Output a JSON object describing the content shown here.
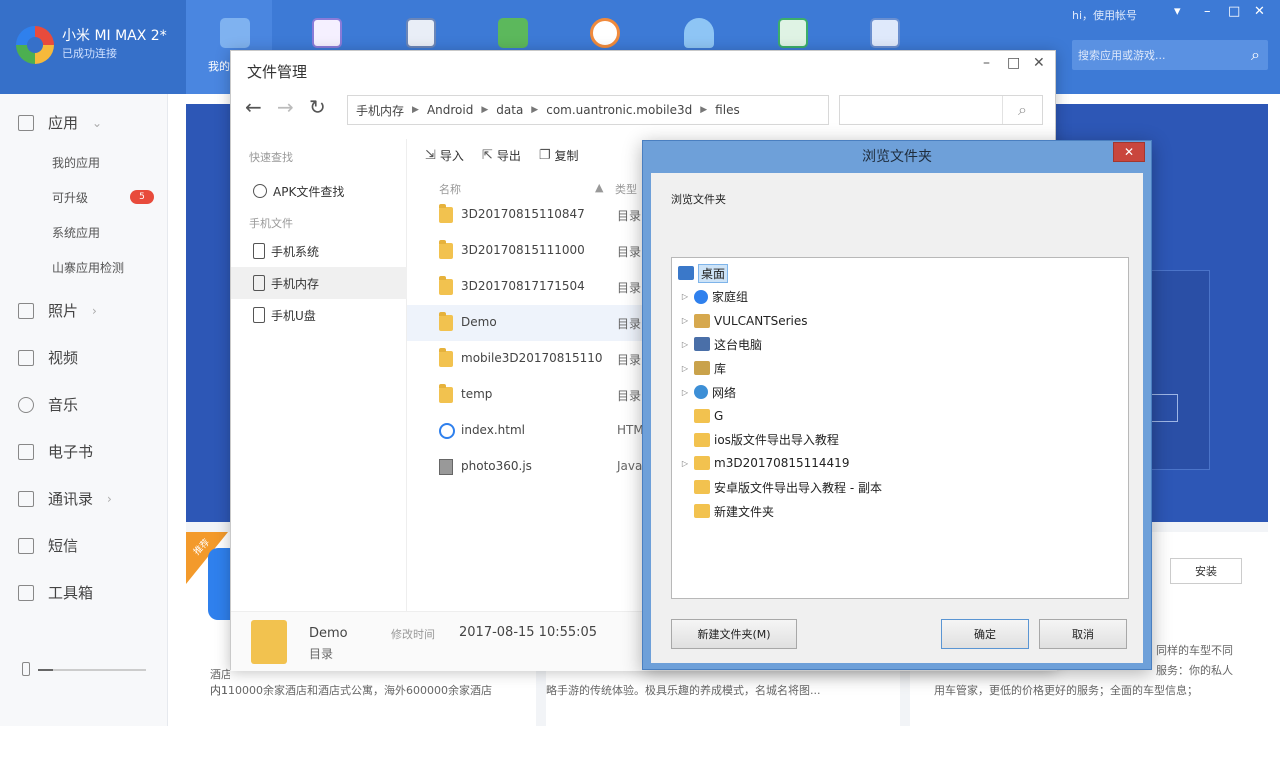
{
  "device": {
    "name": "小米 MI MAX 2*",
    "status": "已成功连接"
  },
  "topbar": {
    "active_tab_label": "我的",
    "greeting": "hi，使用帐号",
    "search_placeholder": "搜索应用或游戏..."
  },
  "sidebar": {
    "apps_label": "应用",
    "sub_items": [
      "我的应用",
      "可升级",
      "系统应用",
      "山寨应用检测"
    ],
    "upgrade_badge": "5",
    "items": [
      "照片",
      "视频",
      "音乐",
      "电子书",
      "通讯录",
      "短信",
      "工具箱"
    ]
  },
  "background": {
    "hot_tag": "推荐",
    "install_label": "安装",
    "card1_line1": "酒店预订更优惠的价格、更实惠、更多推荐",
    "card1_line2": "内110000余家酒店和酒店式公寓，海外600000余家酒店",
    "card2_line": "略手游的传统体验。极具乐趣的养成模式，名城名将图...",
    "card3_line1": "同样的车型不同",
    "card3_line2": "服务：你的私人",
    "card3_line3": "用车管家，更低的价格更好的服务；全面的车型信息；"
  },
  "file_manager": {
    "title": "文件管理",
    "breadcrumbs": [
      "手机内存",
      "Android",
      "data",
      "com.uantronic.mobile3d",
      "files"
    ],
    "quick_search_label": "快速查找",
    "apk_search": "APK文件查找",
    "phone_files_label": "手机文件",
    "nav": [
      "手机系统",
      "手机内存",
      "手机U盘"
    ],
    "toolbar": {
      "import": "导入",
      "export": "导出",
      "copy": "复制"
    },
    "columns": {
      "name": "名称",
      "type": "类型"
    },
    "files": [
      {
        "name": "3D20170815110847",
        "type": "目录",
        "icon": "folder"
      },
      {
        "name": "3D20170815111000",
        "type": "目录",
        "icon": "folder"
      },
      {
        "name": "3D20170817171504",
        "type": "目录",
        "icon": "folder"
      },
      {
        "name": "Demo",
        "type": "目录",
        "icon": "folder"
      },
      {
        "name": "mobile3D20170815110",
        "type": "目录",
        "icon": "folder"
      },
      {
        "name": "temp",
        "type": "目录",
        "icon": "folder"
      },
      {
        "name": "index.html",
        "type": "HTM",
        "icon": "html"
      },
      {
        "name": "photo360.js",
        "type": "Java",
        "icon": "js"
      }
    ],
    "footer": {
      "name": "Demo",
      "type": "目录",
      "modified_label": "修改时间",
      "modified_time": "2017-08-15 10:55:05"
    }
  },
  "browse_dialog": {
    "title": "浏览文件夹",
    "description": "浏览文件夹",
    "tree": [
      {
        "label": "桌面",
        "icon": "desktop",
        "expandable": false,
        "selected": true
      },
      {
        "label": "家庭组",
        "icon": "group",
        "expandable": true
      },
      {
        "label": "VULCANTSeries",
        "icon": "user",
        "expandable": true
      },
      {
        "label": "这台电脑",
        "icon": "pc",
        "expandable": true
      },
      {
        "label": "库",
        "icon": "lib",
        "expandable": true
      },
      {
        "label": "网络",
        "icon": "net",
        "expandable": true
      },
      {
        "label": "G",
        "icon": "folder",
        "expandable": false
      },
      {
        "label": "ios版文件导出导入教程",
        "icon": "folder",
        "expandable": false
      },
      {
        "label": "m3D20170815114419",
        "icon": "folder",
        "expandable": true
      },
      {
        "label": "安卓版文件导出导入教程 - 副本",
        "icon": "folder",
        "expandable": false
      },
      {
        "label": "新建文件夹",
        "icon": "folder",
        "expandable": false
      }
    ],
    "new_folder_button": "新建文件夹(M)",
    "ok_button": "确定",
    "cancel_button": "取消"
  }
}
